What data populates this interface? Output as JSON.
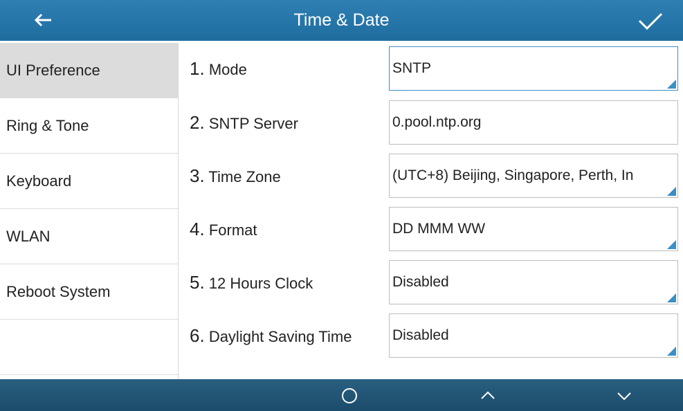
{
  "header": {
    "title": "Time & Date",
    "back_icon": "arrow-left-icon",
    "confirm_icon": "checkmark-icon"
  },
  "sidebar": {
    "items": [
      {
        "label": "UI Preference",
        "active": true
      },
      {
        "label": "Ring & Tone",
        "active": false
      },
      {
        "label": "Keyboard",
        "active": false
      },
      {
        "label": "WLAN",
        "active": false
      },
      {
        "label": "Reboot System",
        "active": false
      }
    ]
  },
  "settings": [
    {
      "num": "1.",
      "label": "Mode",
      "value": "SNTP"
    },
    {
      "num": "2.",
      "label": "SNTP Server",
      "value": "0.pool.ntp.org"
    },
    {
      "num": "3.",
      "label": "Time Zone",
      "value": "(UTC+8) Beijing, Singapore, Perth, In"
    },
    {
      "num": "4.",
      "label": "Format",
      "value": "DD MMM WW"
    },
    {
      "num": "5.",
      "label": "12 Hours Clock",
      "value": "Disabled"
    },
    {
      "num": "6.",
      "label": "Daylight Saving Time",
      "value": "Disabled"
    }
  ],
  "footer": {
    "icons": [
      "circle-icon",
      "chevron-up-icon",
      "chevron-down-icon"
    ]
  },
  "colors": {
    "titlebar": "#1f6d9f",
    "bottombar": "#1c4c6b",
    "accent": "#3a8fc4",
    "active_item": "#dcdcdc"
  }
}
